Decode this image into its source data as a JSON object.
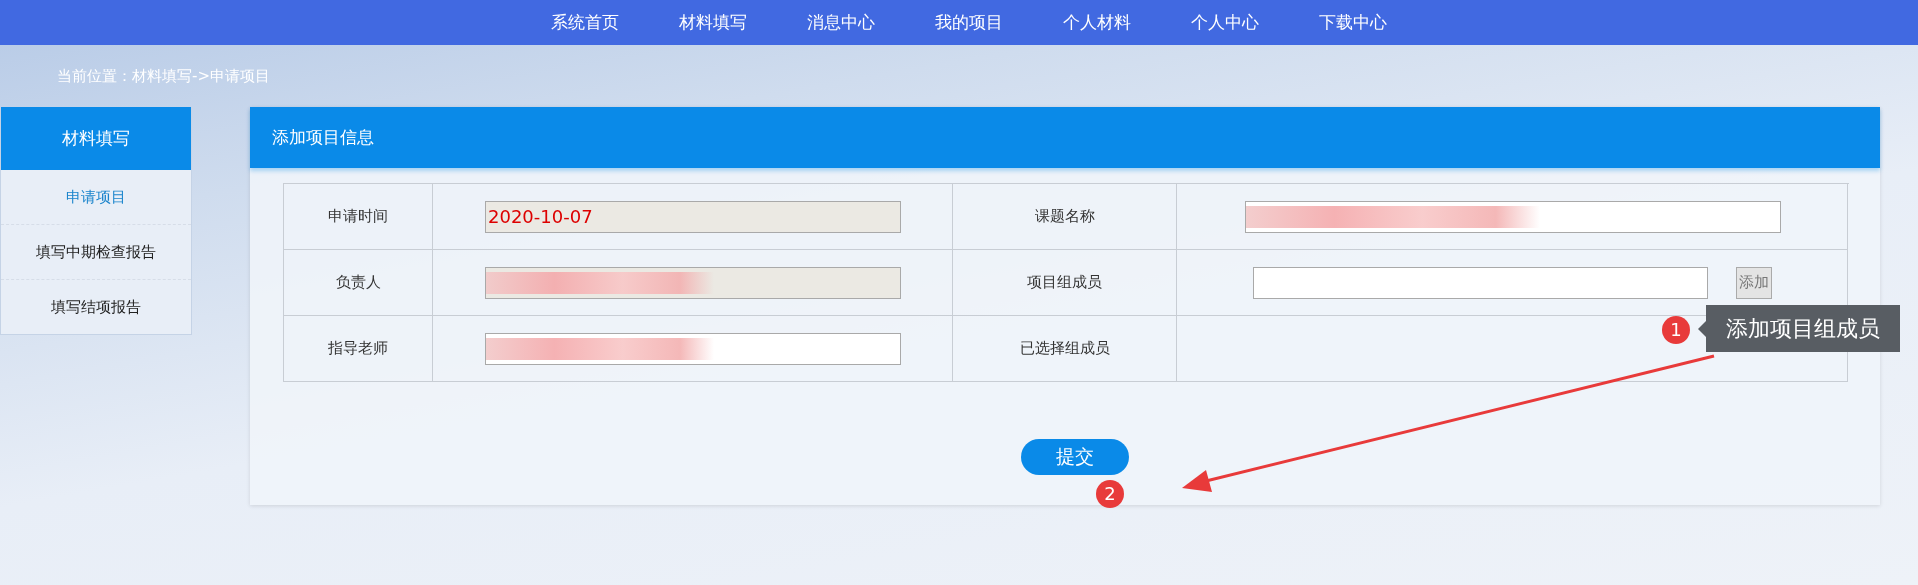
{
  "nav": {
    "items": [
      {
        "label": "系统首页"
      },
      {
        "label": "材料填写"
      },
      {
        "label": "消息中心"
      },
      {
        "label": "我的项目"
      },
      {
        "label": "个人材料"
      },
      {
        "label": "个人中心"
      },
      {
        "label": "下载中心"
      }
    ]
  },
  "breadcrumb": "当前位置：材料填写->申请项目",
  "sidebar": {
    "title": "材料填写",
    "items": [
      {
        "label": "申请项目",
        "selected": true
      },
      {
        "label": "填写中期检查报告",
        "selected": false
      },
      {
        "label": "填写结项报告",
        "selected": false
      }
    ]
  },
  "panel": {
    "title": "添加项目信息",
    "rows": [
      [
        {
          "label": "申请时间",
          "field": {
            "kind": "input",
            "value": "2020-10-07",
            "readonly": true,
            "blurred": false
          }
        },
        {
          "label": "课题名称",
          "field": {
            "kind": "input",
            "readonly": false,
            "blurred": true
          }
        }
      ],
      [
        {
          "label": "负责人",
          "field": {
            "kind": "input",
            "readonly": true,
            "blurred": true
          }
        },
        {
          "label": "项目组成员",
          "field": {
            "kind": "input-button",
            "readonly": false,
            "blurred": false,
            "button": "添加"
          }
        }
      ],
      [
        {
          "label": "指导老师",
          "field": {
            "kind": "input",
            "readonly": false,
            "blurred": true
          }
        },
        {
          "label": "已选择组成员",
          "field": {
            "kind": "empty"
          }
        }
      ]
    ],
    "submit": "提交"
  },
  "annotations": [
    {
      "number": "1",
      "text": "添加项目组成员"
    },
    {
      "number": "2"
    }
  ]
}
